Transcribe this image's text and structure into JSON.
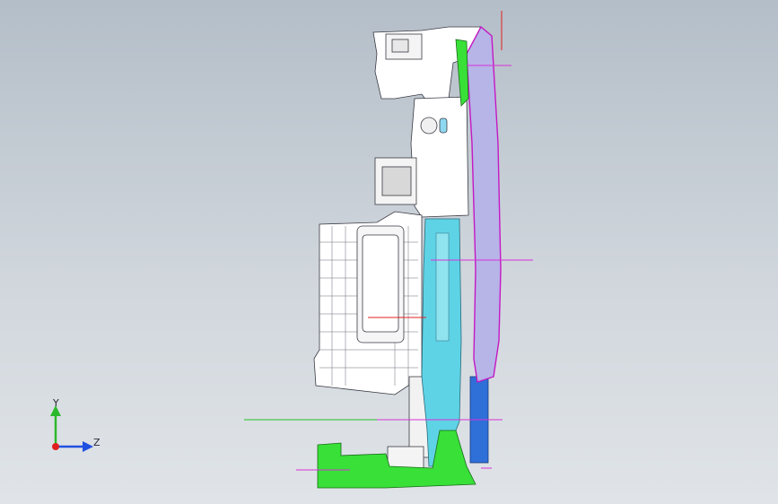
{
  "viewport": {
    "background_top": "#b4bec8",
    "background_bottom": "#e0e4e8",
    "model_view": "side-section"
  },
  "colors": {
    "outline": "#3a3a44",
    "lamp_lens": "#b7b4e8",
    "lamp_edge": "#c418c4",
    "cyan_part": "#5fd3e6",
    "green_part": "#38e038",
    "blue_part": "#2f6fd8",
    "grey_part": "#ffffff",
    "ref_magenta": "#d830d8",
    "ref_green": "#20c020",
    "ref_red": "#e02020"
  },
  "triad": {
    "y_label": "Y",
    "z_label": "Z",
    "y_color": "#2cb82c",
    "z_color": "#2050e0",
    "x_color": "#e02020",
    "icon": "coordinate-triad-icon"
  }
}
